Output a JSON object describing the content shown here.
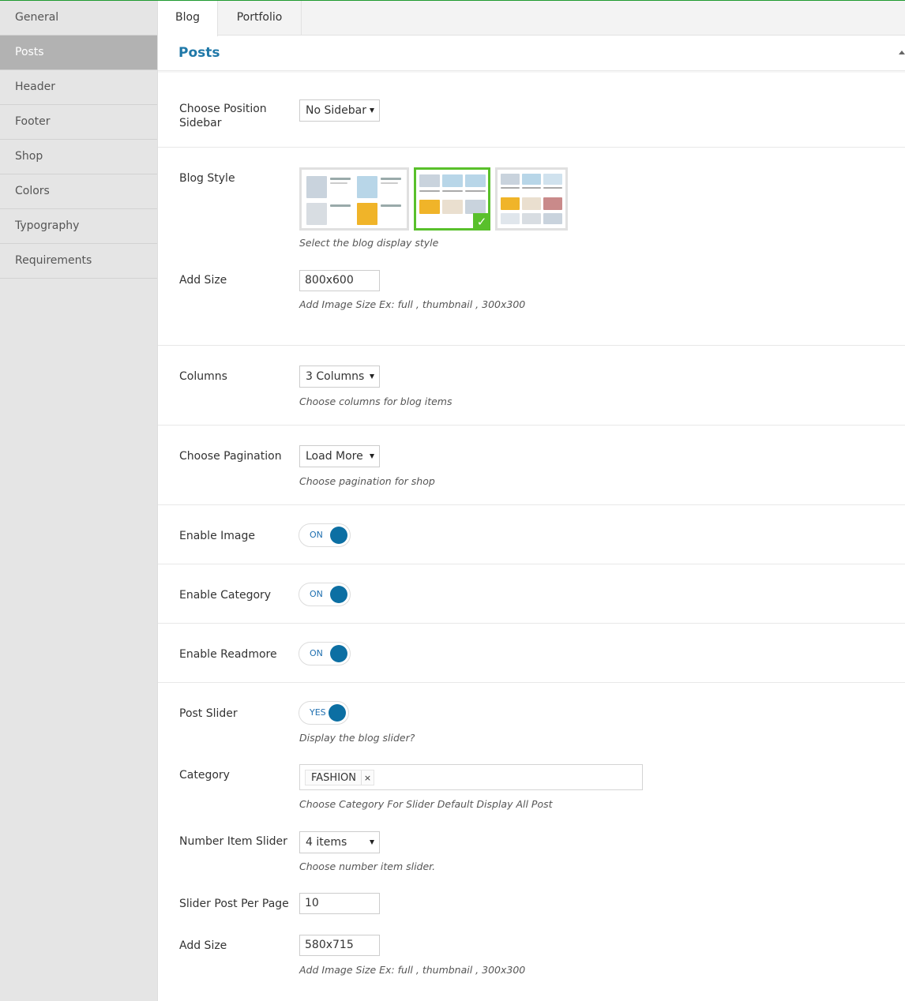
{
  "sidebar": {
    "items": [
      {
        "label": "General"
      },
      {
        "label": "Posts"
      },
      {
        "label": "Header"
      },
      {
        "label": "Footer"
      },
      {
        "label": "Shop"
      },
      {
        "label": "Colors"
      },
      {
        "label": "Typography"
      },
      {
        "label": "Requirements"
      }
    ],
    "active_index": 1
  },
  "tabs": [
    {
      "label": "Blog"
    },
    {
      "label": "Portfolio"
    }
  ],
  "section": {
    "title": "Posts"
  },
  "fields": {
    "sidebar_position": {
      "label": "Choose Position Sidebar",
      "value": "No Sidebar"
    },
    "blog_style": {
      "label": "Blog Style",
      "desc": "Select the blog display style",
      "selected_index": 1
    },
    "add_size": {
      "label": "Add Size",
      "value": "800x600",
      "desc": "Add Image Size Ex: full , thumbnail , 300x300"
    },
    "columns": {
      "label": "Columns",
      "value": "3 Columns",
      "desc": "Choose columns for blog items"
    },
    "pagination": {
      "label": "Choose Pagination",
      "value": "Load More",
      "desc": "Choose pagination for shop"
    },
    "enable_image": {
      "label": "Enable Image",
      "value": "ON"
    },
    "enable_category": {
      "label": "Enable Category",
      "value": "ON"
    },
    "enable_readmore": {
      "label": "Enable Readmore",
      "value": "ON"
    },
    "post_slider": {
      "label": "Post Slider",
      "value": "YES",
      "desc": "Display the blog slider?"
    },
    "category": {
      "label": "Category",
      "tag": "FASHION",
      "remove": "×",
      "desc": "Choose Category For Slider Default Display All Post"
    },
    "number_item_slider": {
      "label": "Number Item Slider",
      "value": "4 items",
      "desc": "Choose number item slider."
    },
    "slider_post_per_page": {
      "label": "Slider Post Per Page",
      "value": "10"
    },
    "slider_add_size": {
      "label": "Add Size",
      "value": "580x715",
      "desc": "Add Image Size Ex: full , thumbnail , 300x300"
    }
  },
  "colors": {
    "accent": "#1f78a8",
    "toggle": "#0c6fa3",
    "selected": "#59c02b"
  }
}
